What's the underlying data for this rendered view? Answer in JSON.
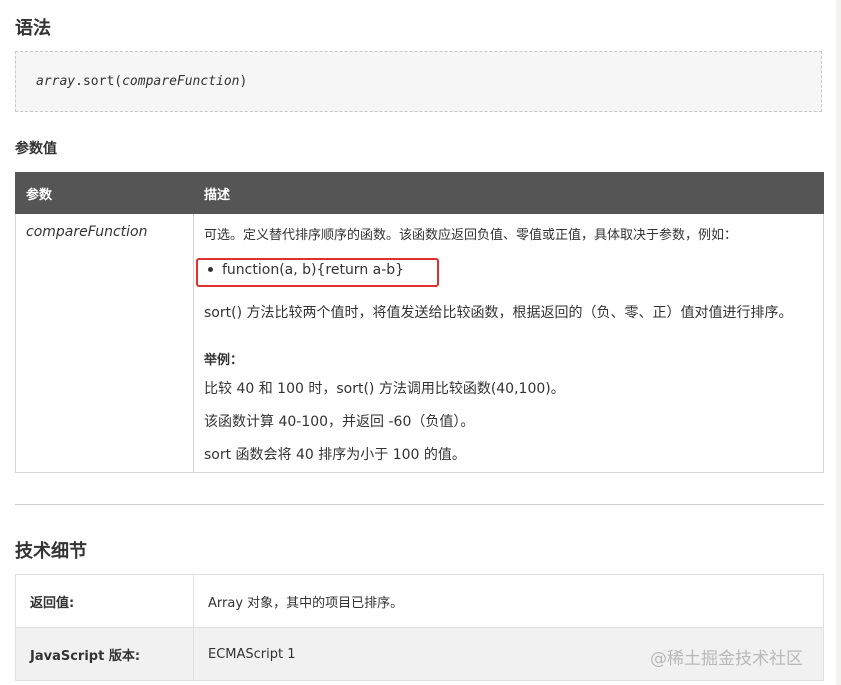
{
  "syntax": {
    "heading": "语法",
    "code_object": "array",
    "code_method": ".sort(",
    "code_param": "compareFunction",
    "code_close": ")"
  },
  "params": {
    "heading": "参数值",
    "columns": [
      "参数",
      "描述"
    ],
    "row": {
      "name": "compareFunction",
      "desc_intro": "可选。定义替代排序顺序的函数。该函数应返回负值、零值或正值，具体取决于参数，例如：",
      "bullet": "function(a, b){return a-b}",
      "desc_sort": "sort() 方法比较两个值时，将值发送给比较函数，根据返回的（负、零、正）值对值进行排序。",
      "example_heading": "举例：",
      "example_1": "比较 40 和 100 时，sort() 方法调用比较函数(40,100)。",
      "example_2": "该函数计算 40-100，并返回 -60（负值）。",
      "example_3": "sort 函数会将 40 排序为小于 100 的值。"
    }
  },
  "tech": {
    "heading": "技术细节",
    "rows": [
      {
        "key": "返回值:",
        "value": "Array 对象，其中的项目已排序。"
      },
      {
        "key": "JavaScript 版本:",
        "value": "ECMAScript 1"
      }
    ]
  },
  "watermark": "@稀土掘金技术社区",
  "colors": {
    "table_header_bg": "#555555",
    "highlight_border": "#e03030"
  }
}
